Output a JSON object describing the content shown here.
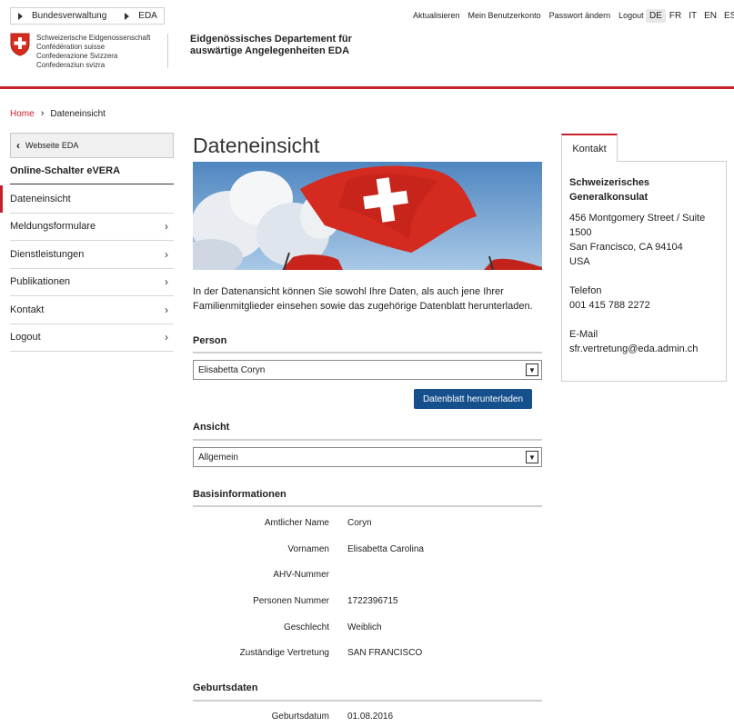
{
  "topbar": {
    "crumb1": "Bundesverwaltung",
    "crumb2": "EDA",
    "links": [
      "Aktualisieren",
      "Mein Benutzerkonto",
      "Passwort ändern",
      "Logout"
    ],
    "languages": [
      "DE",
      "FR",
      "IT",
      "EN",
      "ES"
    ],
    "active_language": "DE"
  },
  "header": {
    "confederation": [
      "Schweizerische Eidgenossenschaft",
      "Confédération suisse",
      "Confederazione Svizzera",
      "Confederaziun svizra"
    ],
    "department_line1": "Eidgenössisches Departement für",
    "department_line2": "auswärtige Angelegenheiten EDA"
  },
  "breadcrumb": {
    "home": "Home",
    "current": "Dateneinsicht"
  },
  "sidebar": {
    "back_label": "Webseite EDA",
    "title": "Online-Schalter eVERA",
    "items": [
      {
        "label": "Dateneinsicht",
        "active": true,
        "chevron": false
      },
      {
        "label": "Meldungsformulare",
        "active": false,
        "chevron": true
      },
      {
        "label": "Dienstleistungen",
        "active": false,
        "chevron": true
      },
      {
        "label": "Publikationen",
        "active": false,
        "chevron": true
      },
      {
        "label": "Kontakt",
        "active": false,
        "chevron": true
      },
      {
        "label": "Logout",
        "active": false,
        "chevron": true
      }
    ]
  },
  "main": {
    "title": "Dateneinsicht",
    "intro": "In der Datenansicht können Sie sowohl Ihre Daten, als auch jene Ihrer Familienmitglieder einsehen sowie das zugehörige Datenblatt herunterladen.",
    "person_label": "Person",
    "person_value": "Elisabetta Coryn",
    "download_label": "Datenblatt herunterladen",
    "view_label": "Ansicht",
    "view_value": "Allgemein",
    "basis_title": "Basisinformationen",
    "basis": [
      {
        "key": "Amtlicher Name",
        "value": "Coryn"
      },
      {
        "key": "Vornamen",
        "value": "Elisabetta Carolina"
      },
      {
        "key": "AHV-Nummer",
        "value": ""
      },
      {
        "key": "Personen Nummer",
        "value": "1722396715"
      },
      {
        "key": "Geschlecht",
        "value": "Weiblich"
      },
      {
        "key": "Zuständige Vertretung",
        "value": "SAN FRANCISCO"
      }
    ],
    "birth_title": "Geburtsdaten",
    "birth": [
      {
        "key": "Geburtsdatum",
        "value": "01.08.2016"
      }
    ]
  },
  "contact": {
    "tab": "Kontakt",
    "org_line1": "Schweizerisches",
    "org_line2": "Generalkonsulat",
    "address": [
      "456 Montgomery Street / Suite",
      "1500",
      "San Francisco, CA 94104",
      "USA"
    ],
    "phone_label": "Telefon",
    "phone": "001 415 788 2272",
    "email_label": "E-Mail",
    "email": "sfr.vertretung@eda.admin.ch"
  },
  "colors": {
    "accent": "#c8202b",
    "button": "#15508c"
  }
}
